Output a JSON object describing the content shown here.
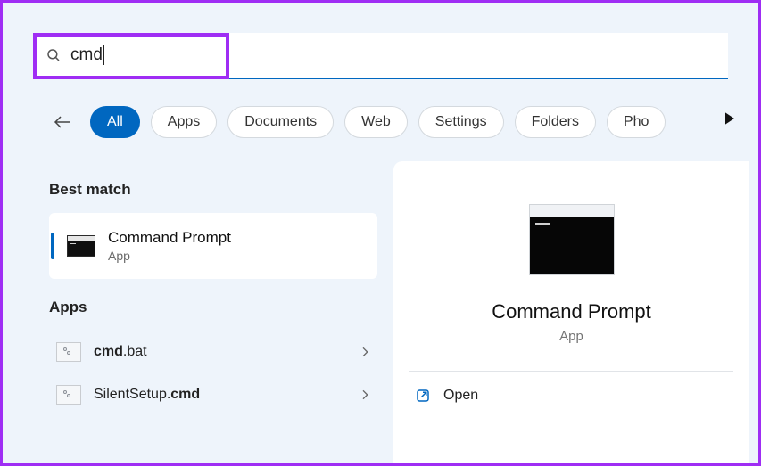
{
  "search": {
    "query": "cmd"
  },
  "filters": {
    "items": [
      {
        "label": "All",
        "active": true
      },
      {
        "label": "Apps",
        "active": false
      },
      {
        "label": "Documents",
        "active": false
      },
      {
        "label": "Web",
        "active": false
      },
      {
        "label": "Settings",
        "active": false
      },
      {
        "label": "Folders",
        "active": false
      },
      {
        "label": "Pho",
        "active": false
      }
    ]
  },
  "left": {
    "bestMatchHeader": "Best match",
    "bestMatch": {
      "title": "Command Prompt",
      "subtitle": "App"
    },
    "appsHeader": "Apps",
    "apps": [
      {
        "prefix": "cmd",
        "suffix": ".bat"
      },
      {
        "prefix": "SilentSetup.",
        "suffix": "cmd"
      }
    ]
  },
  "right": {
    "title": "Command Prompt",
    "kind": "App",
    "open": "Open"
  }
}
